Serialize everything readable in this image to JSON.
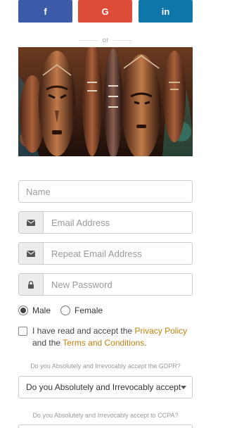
{
  "social": {
    "facebook": {
      "label": "f",
      "color": "#3b5ba8"
    },
    "google": {
      "label": "G",
      "color": "#dd4b39"
    },
    "linkedin": {
      "label": "in",
      "color": "#0e76a8"
    }
  },
  "divider_text": "or",
  "hero_image": {
    "subject": "carved-african-masks"
  },
  "form": {
    "name_placeholder": "Name",
    "email_placeholder": "Email Address",
    "repeat_email_placeholder": "Repeat Email Address",
    "password_placeholder": "New Password",
    "gender": {
      "options": [
        "Male",
        "Female"
      ],
      "selected": "Male"
    },
    "consent": {
      "checked": false,
      "text_before": "I have read and accept the ",
      "privacy_link": "Privacy Policy",
      "text_middle": " and the ",
      "terms_link": "Terms and Conditions",
      "text_after": "."
    },
    "gdpr_question": "Do you Absolutely and Irrevocably accept the GDPR?",
    "gdpr_select_value": "Do you Absolutely and Irrevocably accept",
    "ccpa_question": "Do you Absolutely and Irrevocably accept to CCPA?"
  },
  "icons": {
    "email": "envelope-icon",
    "password": "lock-icon",
    "select": "caret-down-icon"
  }
}
